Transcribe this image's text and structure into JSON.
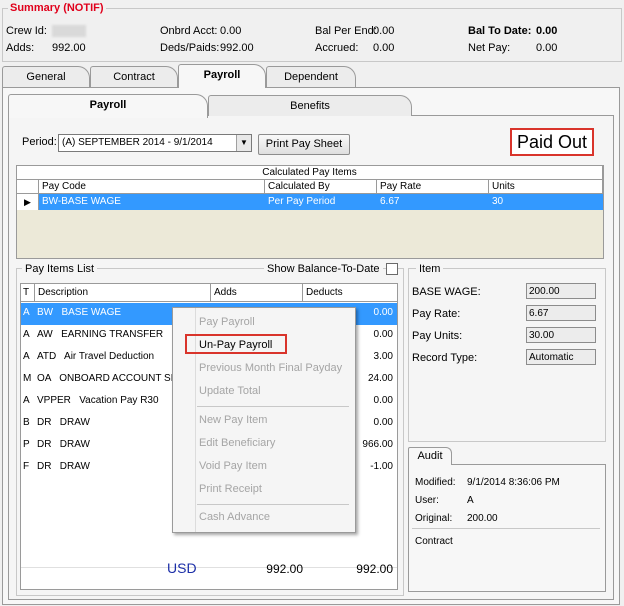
{
  "summary": {
    "title": "Summary (NOTIF)",
    "crew_id_label": "Crew Id:",
    "adds_label": "Adds:",
    "adds_value": "992.00",
    "onbrd_label": "Onbrd Acct:",
    "onbrd_value": "0.00",
    "deds_label": "Deds/Paids:",
    "deds_value": "992.00",
    "bal_per_end_label": "Bal Per End:",
    "bal_per_end_value": "0.00",
    "accrued_label": "Accrued:",
    "accrued_value": "0.00",
    "bal_to_date_label": "Bal To Date:",
    "bal_to_date_value": "0.00",
    "net_pay_label": "Net Pay:",
    "net_pay_value": "0.00"
  },
  "main_tabs": [
    "General",
    "Contract",
    "Payroll",
    "Dependent"
  ],
  "sub_tabs": [
    "Payroll",
    "Benefits"
  ],
  "period": {
    "label": "Period:",
    "value": "(A)  SEPTEMBER 2014 - 9/1/2014",
    "print_button": "Print Pay Sheet",
    "status": "Paid Out"
  },
  "calc_grid": {
    "title": "Calculated Pay Items",
    "headers": [
      "Pay Code",
      "Calculated By",
      "Pay Rate",
      "Units"
    ],
    "row": [
      "BW-BASE WAGE",
      "Per Pay Period",
      "6.67",
      "30"
    ]
  },
  "pay_items": {
    "title": "Pay Items List",
    "show_balance": "Show Balance-To-Date",
    "headers": [
      "T",
      "Description",
      "Adds",
      "Deducts"
    ],
    "rows": [
      {
        "t": "A",
        "desc": "BW   BASE WAGE",
        "deducts": "0.00"
      },
      {
        "t": "A",
        "desc": "AW   EARNING TRANSFER",
        "deducts": "0.00"
      },
      {
        "t": "A",
        "desc": "ATD   Air Travel Deduction",
        "deducts": "3.00"
      },
      {
        "t": "M",
        "desc": "OA   ONBOARD ACCOUNT SETTL",
        "deducts": "24.00"
      },
      {
        "t": "A",
        "desc": "VPPER   Vacation Pay R30",
        "deducts": "0.00"
      },
      {
        "t": "B",
        "desc": "DR   DRAW",
        "deducts": "0.00"
      },
      {
        "t": "P",
        "desc": "DR   DRAW",
        "deducts": "966.00"
      },
      {
        "t": "F",
        "desc": "DR   DRAW",
        "deducts": "-1.00"
      }
    ],
    "currency": "USD",
    "total_adds": "992.00",
    "total_deducts": "992.00"
  },
  "item_panel": {
    "title": "Item",
    "base_wage_label": "BASE WAGE:",
    "base_wage_value": "200.00",
    "pay_rate_label": "Pay Rate:",
    "pay_rate_value": "6.67",
    "pay_units_label": "Pay Units:",
    "pay_units_value": "30.00",
    "record_type_label": "Record Type:",
    "record_type_value": "Automatic"
  },
  "audit": {
    "tab": "Audit",
    "modified_label": "Modified:",
    "modified_value": "9/1/2014 8:36:06 PM",
    "user_label": "User:",
    "user_value": "A",
    "original_label": "Original:",
    "original_value": "200.00",
    "contract_label": "Contract"
  },
  "context_menu": {
    "pay_payroll": "Pay Payroll",
    "unpay_payroll": "Un-Pay Payroll",
    "prev_month_final": "Previous Month Final Payday",
    "update_total": "Update Total",
    "new_pay_item": "New Pay Item",
    "edit_beneficiary": "Edit Beneficiary",
    "void_pay_item": "Void Pay Item",
    "print_receipt": "Print Receipt",
    "cash_advance": "Cash Advance"
  },
  "colors": {
    "accent_red": "#e0001b",
    "selection_blue": "#3399ff",
    "currency_blue": "#1c2fa8"
  }
}
